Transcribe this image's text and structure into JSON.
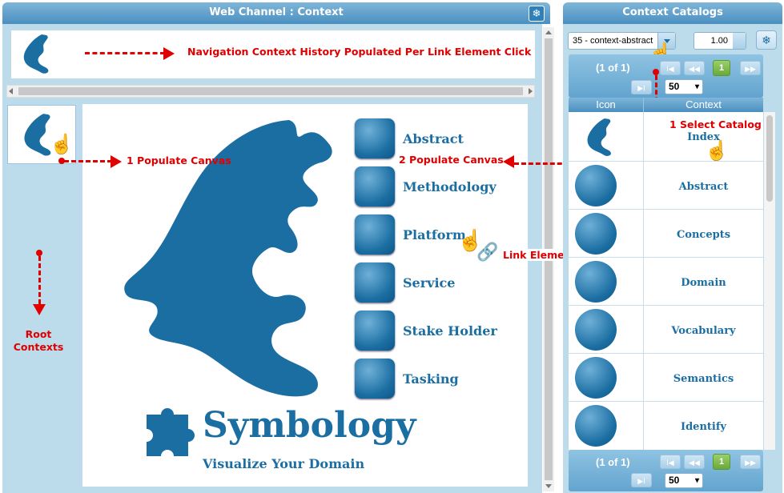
{
  "left_panel": {
    "title": "Web Channel : Context",
    "history_annotation": "Navigation Context History Populated Per Link Element Click",
    "populate_annotation_1": "1 Populate Canvas",
    "populate_annotation_2": "2 Populate Canvas",
    "root_annotation": "Root Contexts",
    "link_annotation": "Link Element Navigate to the next Context",
    "menu_items": [
      "Abstract",
      "Methodology",
      "Platform",
      "Service",
      "Stake Holder",
      "Tasking"
    ],
    "brand_title": "Symbology",
    "brand_tagline": "Visualize Your Domain"
  },
  "right_panel": {
    "title": "Context Catalogs",
    "catalog_select": "35 - context-abstract",
    "zoom_value": "1.00",
    "pager_text": "(1 of 1)",
    "page_number": "1",
    "page_size": "50",
    "col_icon": "Icon",
    "col_context": "Context",
    "select_annotation": "1 Select Catalog",
    "rows": [
      "Index",
      "Abstract",
      "Concepts",
      "Domain",
      "Vocabulary",
      "Semantics",
      "Identify"
    ]
  },
  "colors": {
    "accent": "#1b6ea2",
    "header": "#4a8fc0",
    "panel": "#bcdcec",
    "annotation": "#e00000",
    "link": "#2aa02a"
  }
}
